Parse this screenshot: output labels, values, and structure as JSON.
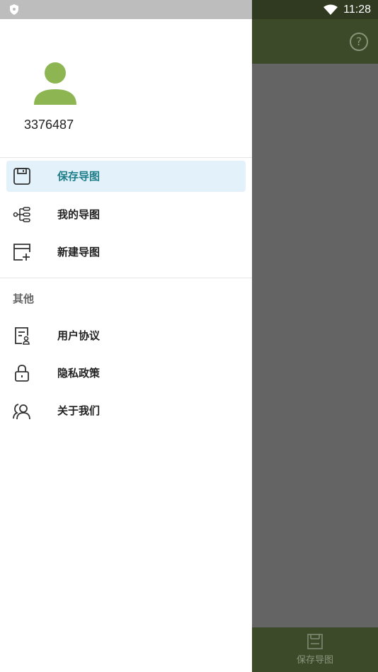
{
  "status_bar": {
    "time": "11:28"
  },
  "toolbar": {
    "help_icon": "help-circle-icon",
    "help_glyph": "?"
  },
  "bottom_bar": {
    "tab_label": "保存导图",
    "tab_icon": "save-icon"
  },
  "drawer": {
    "user": {
      "id": "3376487",
      "avatar_color": "#8db653"
    },
    "menu_items": [
      {
        "label": "保存导图",
        "icon": "save-icon",
        "active": true
      },
      {
        "label": "我的导图",
        "icon": "mindmap-icon",
        "active": false
      },
      {
        "label": "新建导图",
        "icon": "new-map-icon",
        "active": false
      }
    ],
    "other_section": {
      "title": "其他",
      "items": [
        {
          "label": "用户协议",
          "icon": "agreement-icon"
        },
        {
          "label": "隐私政策",
          "icon": "lock-icon"
        },
        {
          "label": "关于我们",
          "icon": "about-us-icon"
        }
      ]
    }
  },
  "colors": {
    "accent": "#1d7e8a",
    "active_bg": "#e3f1fb",
    "toolbar": "#3d4a2a",
    "scrim": "#646464"
  }
}
